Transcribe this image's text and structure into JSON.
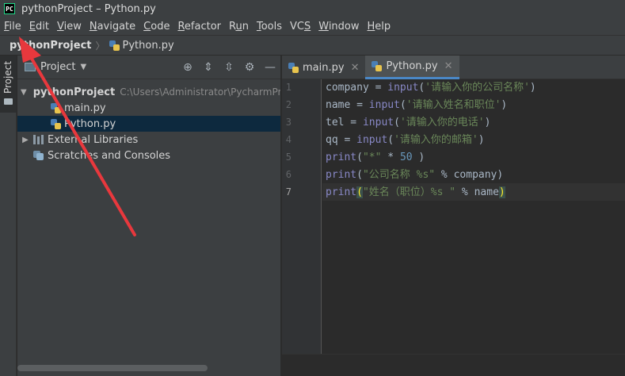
{
  "window": {
    "title": "pythonProject – Python.py",
    "logo_text": "PC"
  },
  "menu": [
    {
      "label": "File",
      "mnemonic_index": 0
    },
    {
      "label": "Edit",
      "mnemonic_index": 0
    },
    {
      "label": "View",
      "mnemonic_index": 0
    },
    {
      "label": "Navigate",
      "mnemonic_index": 0
    },
    {
      "label": "Code",
      "mnemonic_index": 0
    },
    {
      "label": "Refactor",
      "mnemonic_index": 0
    },
    {
      "label": "Run",
      "mnemonic_index": 1
    },
    {
      "label": "Tools",
      "mnemonic_index": 0
    },
    {
      "label": "VCS",
      "mnemonic_index": 2
    },
    {
      "label": "Window",
      "mnemonic_index": 0
    },
    {
      "label": "Help",
      "mnemonic_index": 0
    }
  ],
  "breadcrumb": {
    "project": "pythonProject",
    "file": "Python.py"
  },
  "side_strip": {
    "label": "Project"
  },
  "project_panel": {
    "title": "Project",
    "tools": [
      "crosshair-icon",
      "expand-all-icon",
      "collapse-all-icon",
      "gear-icon",
      "minimize-icon"
    ],
    "tree": {
      "root_name": "pythonProject",
      "root_path": "C:\\Users\\Administrator\\PycharmPr",
      "files": [
        "main.py",
        "Python.py"
      ],
      "selected_file": "Python.py",
      "external_libraries": "External Libraries",
      "scratches": "Scratches and Consoles"
    }
  },
  "editor": {
    "tabs": [
      {
        "label": "main.py",
        "active": false
      },
      {
        "label": "Python.py",
        "active": true
      }
    ],
    "line_numbers": [
      "1",
      "2",
      "3",
      "4",
      "5",
      "6",
      "7"
    ],
    "current_line": "7",
    "code": [
      [
        {
          "t": "company = ",
          "c": ""
        },
        {
          "t": "input",
          "c": "fn"
        },
        {
          "t": "(",
          "c": ""
        },
        {
          "t": "'请输入你的公司名称'",
          "c": "str"
        },
        {
          "t": ")",
          "c": ""
        }
      ],
      [
        {
          "t": "name = ",
          "c": ""
        },
        {
          "t": "input",
          "c": "fn"
        },
        {
          "t": "(",
          "c": ""
        },
        {
          "t": "'请输入姓名和职位'",
          "c": "str"
        },
        {
          "t": ")",
          "c": ""
        }
      ],
      [
        {
          "t": "tel = ",
          "c": ""
        },
        {
          "t": "input",
          "c": "fn"
        },
        {
          "t": "(",
          "c": ""
        },
        {
          "t": "'请输入你的电话'",
          "c": "str"
        },
        {
          "t": ")",
          "c": ""
        }
      ],
      [
        {
          "t": "qq = ",
          "c": ""
        },
        {
          "t": "input",
          "c": "fn"
        },
        {
          "t": "(",
          "c": ""
        },
        {
          "t": "'请输入你的邮箱'",
          "c": "str"
        },
        {
          "t": ")",
          "c": ""
        }
      ],
      [
        {
          "t": "print",
          "c": "fn"
        },
        {
          "t": "(",
          "c": ""
        },
        {
          "t": "\"*\"",
          "c": "str"
        },
        {
          "t": " * ",
          "c": ""
        },
        {
          "t": "50",
          "c": "num"
        },
        {
          "t": " )",
          "c": ""
        }
      ],
      [
        {
          "t": "print",
          "c": "fn"
        },
        {
          "t": "(",
          "c": ""
        },
        {
          "t": "\"公司名称 %s\"",
          "c": "str"
        },
        {
          "t": " % company)",
          "c": ""
        }
      ],
      [
        {
          "t": "print",
          "c": "fn"
        },
        {
          "t": "(",
          "c": "brk"
        },
        {
          "t": "\"姓名（职位）%s \"",
          "c": "str"
        },
        {
          "t": " % name",
          "c": ""
        },
        {
          "t": ")",
          "c": "brk"
        }
      ]
    ]
  },
  "colors": {
    "annotation_arrow": "#e8383d",
    "keyword_fn": "#8888c6",
    "string": "#6a8759",
    "number": "#6897bb"
  }
}
